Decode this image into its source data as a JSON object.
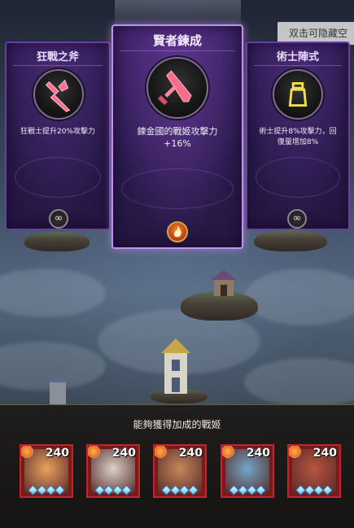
{
  "hint": {
    "label": "双击可隐藏空"
  },
  "cards": [
    {
      "title": "狂戰之斧",
      "desc": "狂戰士提升20%攻擊力",
      "emblem_icon": "axe-icon",
      "emblem_color": "#ff6b8a",
      "badge": "∞",
      "selected": false
    },
    {
      "title": "賢者鍊成",
      "desc_line1": "鍊金國的戰姬攻擊力",
      "desc_line2": "+16%",
      "emblem_icon": "sword-icon",
      "emblem_color": "#ff6b8a",
      "badge_icon": "flame-icon",
      "selected": true
    },
    {
      "title": "術士陣式",
      "desc_line1": "術士提升8%攻擊力，回",
      "desc_line2": "復量增加8%",
      "emblem_icon": "potion-icon",
      "emblem_color": "#f4e04d",
      "badge": "∞",
      "selected": false
    }
  ],
  "panel": {
    "title": "能夠獲得加成的戰姬",
    "heroes": [
      {
        "level": "240",
        "face": "#e9a35e"
      },
      {
        "level": "240",
        "face": "#d8d1c8"
      },
      {
        "level": "240",
        "face": "#c48a5a"
      },
      {
        "level": "240",
        "face": "#6fa8c8"
      },
      {
        "level": "240",
        "face": "#b8553e"
      }
    ]
  }
}
